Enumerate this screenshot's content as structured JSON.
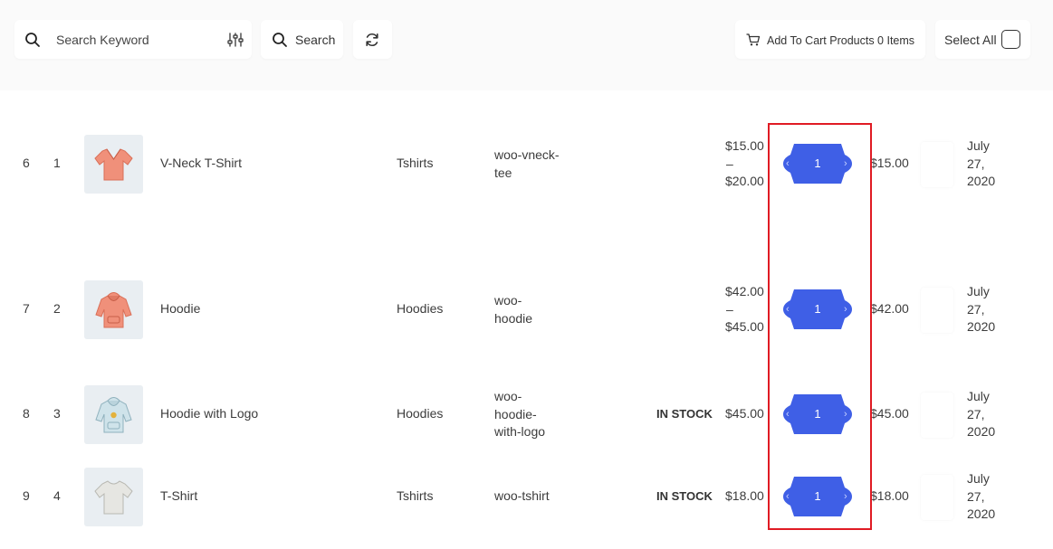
{
  "toolbar": {
    "search_placeholder": "Search Keyword",
    "search_label": "Search",
    "cart_label": "Add To Cart Products 0 Items",
    "select_all_label": "Select All"
  },
  "colors": {
    "accent": "#3f5fe6",
    "highlight_border": "#e01b24",
    "thumb_bg": "#e9eef2"
  },
  "rows": [
    {
      "index": "6",
      "number": "1",
      "name": "V-Neck T-Shirt",
      "category": "Tshirts",
      "sku_lines": [
        "woo-vneck-",
        "tee"
      ],
      "stock": "",
      "price_lines": [
        "$15.00",
        "–",
        "$20.00"
      ],
      "quantity": "1",
      "total": "$15.00",
      "date_lines": [
        "July",
        "27,",
        "2020"
      ],
      "thumb_icon": "vneck-tshirt-icon"
    },
    {
      "index": "7",
      "number": "2",
      "name": "Hoodie",
      "category": "Hoodies",
      "sku_lines": [
        "woo-",
        "hoodie"
      ],
      "stock": "",
      "price_lines": [
        "$42.00",
        "–",
        "$45.00"
      ],
      "quantity": "1",
      "total": "$42.00",
      "date_lines": [
        "July",
        "27,",
        "2020"
      ],
      "thumb_icon": "hoodie-icon"
    },
    {
      "index": "8",
      "number": "3",
      "name": "Hoodie with Logo",
      "category": "Hoodies",
      "sku_lines": [
        "woo-",
        "hoodie-",
        "with-logo"
      ],
      "stock": "IN STOCK",
      "price_lines": [
        "$45.00"
      ],
      "quantity": "1",
      "total": "$45.00",
      "date_lines": [
        "July",
        "27,",
        "2020"
      ],
      "thumb_icon": "hoodie-with-logo-icon"
    },
    {
      "index": "9",
      "number": "4",
      "name": "T-Shirt",
      "category": "Tshirts",
      "sku_lines": [
        "woo-tshirt"
      ],
      "stock": "IN STOCK",
      "price_lines": [
        "$18.00"
      ],
      "quantity": "1",
      "total": "$18.00",
      "date_lines": [
        "July",
        "27,",
        "2020"
      ],
      "thumb_icon": "tshirt-icon"
    }
  ]
}
